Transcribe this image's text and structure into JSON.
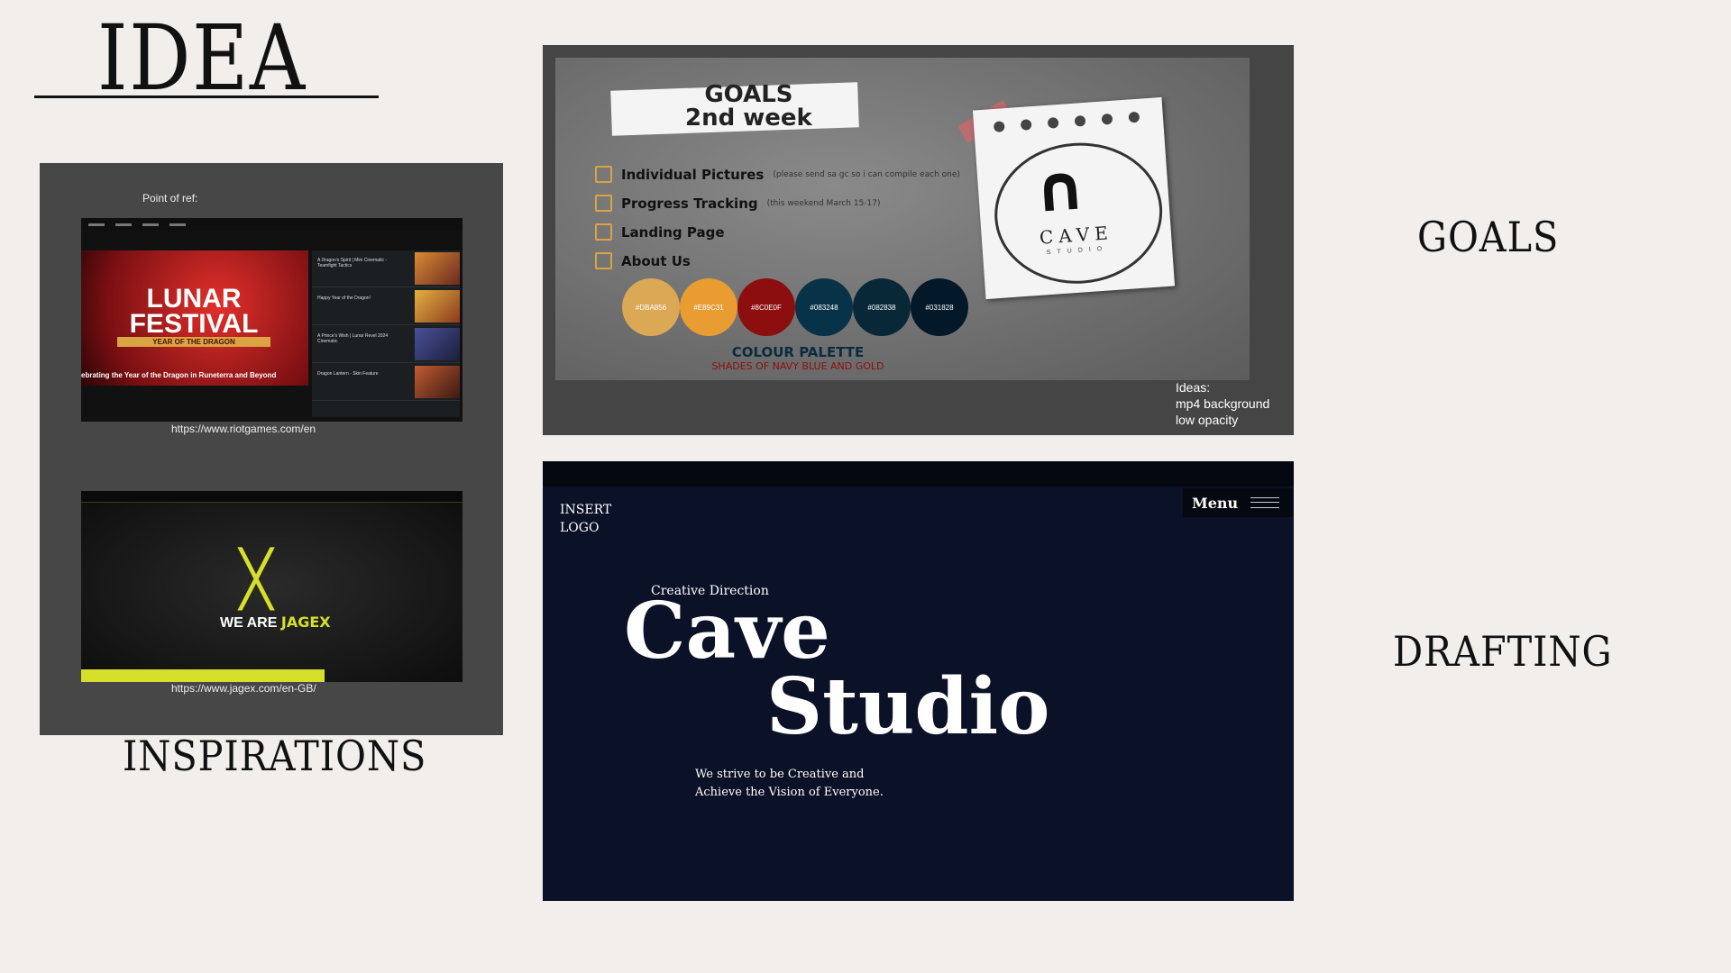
{
  "page": {
    "title": "IDEA",
    "sections": {
      "inspirations": "INSPIRATIONS",
      "goals": "GOALS",
      "drafting": "DRAFTING"
    }
  },
  "inspirations": {
    "point_of_ref": "Point of ref:",
    "riot": {
      "url": "https://www.riotgames.com/en",
      "hero_title_1": "LUNAR",
      "hero_title_2": "FESTIVAL",
      "hero_subtitle": "YEAR OF THE DRAGON",
      "hero_caption": "ebrating the Year of the Dragon in Runeterra and Beyond",
      "side_items": [
        "A Dragon's Spirit | Mini Cinematic - Teamfight Tactics",
        "Happy Year of the Dragon!",
        "A Prince's Wish | Lunar Revel 2024 Cinematic",
        "Dragon Lantern - Skin Feature"
      ]
    },
    "jagex": {
      "url": "https://www.jagex.com/en-GB/",
      "tagline_1": "WE ARE ",
      "tagline_2": "JAGEX"
    }
  },
  "goals": {
    "heading_1": "GOALS",
    "heading_2": "2nd week",
    "items": [
      {
        "label": "Individual Pictures",
        "note": "(please send sa gc so i can compile each one)"
      },
      {
        "label": "Progress Tracking",
        "note": "(this weekend March 15-17)"
      },
      {
        "label": "Landing Page",
        "note": ""
      },
      {
        "label": "About Us",
        "note": ""
      }
    ],
    "palette": [
      {
        "hex": "#DBA856",
        "color": "#dba856"
      },
      {
        "hex": "#E89C31",
        "color": "#e89c31"
      },
      {
        "hex": "#8C0E0F",
        "color": "#8c0e0f"
      },
      {
        "hex": "#083248",
        "color": "#083248"
      },
      {
        "hex": "#082838",
        "color": "#082838"
      },
      {
        "hex": "#031828",
        "color": "#031828"
      }
    ],
    "palette_title": "COLOUR PALETTE",
    "palette_subtitle": "SHADES OF NAVY BLUE AND GOLD",
    "logo_text": "CAVE",
    "logo_sub": "STUDIO",
    "ideas_lines": [
      "Ideas:",
      "mp4 background",
      "low opacity"
    ]
  },
  "drafting": {
    "insert_logo_1": "INSERT",
    "insert_logo_2": "LOGO",
    "menu_label": "Menu",
    "kicker": "Creative Direction",
    "headline_1": "Cave",
    "headline_2": "Studio",
    "tagline_1": "We strive to be Creative and",
    "tagline_2": "Achieve the Vision of Everyone."
  }
}
